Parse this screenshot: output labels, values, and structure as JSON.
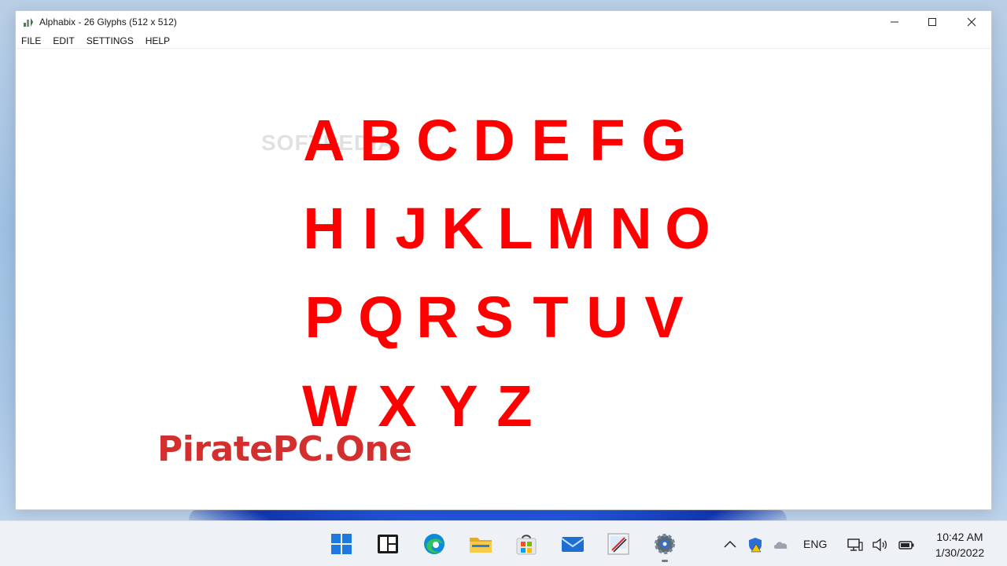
{
  "window": {
    "title": "Alphabix - 26 Glyphs (512 x 512)",
    "controls": {
      "minimize": "—",
      "maximize": "☐",
      "close": "✕"
    }
  },
  "menu": [
    "FILE",
    "EDIT",
    "SETTINGS",
    "HELP"
  ],
  "glyph_rows": [
    [
      "A",
      "B",
      "C",
      "D",
      "E",
      "F",
      "G"
    ],
    [
      "H",
      "I",
      "J",
      "K",
      "L",
      "M",
      "N",
      "O"
    ],
    [
      "P",
      "Q",
      "R",
      "S",
      "T",
      "U",
      "V"
    ],
    [
      "W",
      "X",
      "Y",
      "Z"
    ]
  ],
  "glyph_color": "#ff0000",
  "faint_watermark": "SOFTPEDIA",
  "watermark": "PiratePC.One",
  "watermark_color": "#d32f2f",
  "taskbar": {
    "apps": [
      "windows-start-icon",
      "task-view-icon",
      "edge-browser-icon",
      "file-explorer-icon",
      "microsoft-store-icon",
      "mail-icon",
      "paint-app-icon",
      "settings-gear-icon"
    ],
    "tray": {
      "language": "ENG",
      "time": "10:42 AM",
      "date": "1/30/2022"
    }
  }
}
